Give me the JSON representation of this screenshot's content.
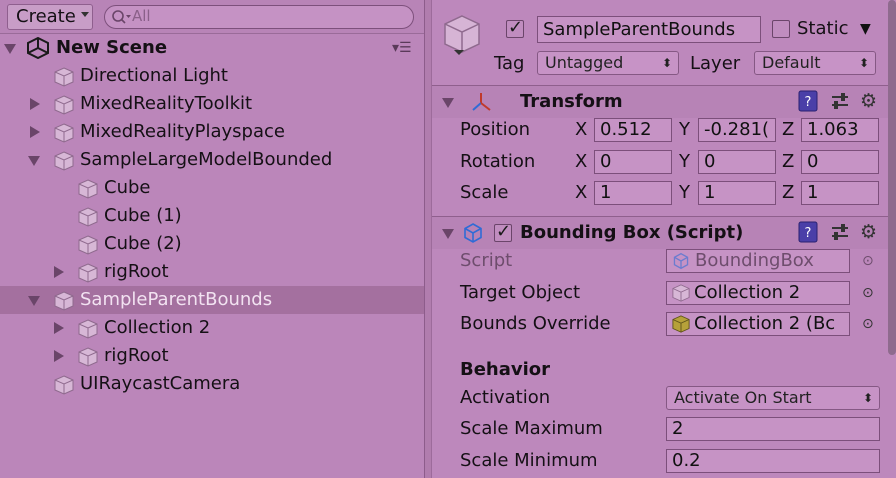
{
  "hierarchy": {
    "create_label": "Create",
    "search_placeholder": "All",
    "scene_name": "New Scene",
    "items": [
      {
        "label": "Directional Light"
      },
      {
        "label": "MixedRealityToolkit"
      },
      {
        "label": "MixedRealityPlayspace"
      },
      {
        "label": "SampleLargeModelBounded"
      },
      {
        "label": "Cube"
      },
      {
        "label": "Cube (1)"
      },
      {
        "label": "Cube (2)"
      },
      {
        "label": "rigRoot"
      },
      {
        "label": "SampleParentBounds",
        "selected": true
      },
      {
        "label": "Collection 2"
      },
      {
        "label": "rigRoot"
      },
      {
        "label": "UIRaycastCamera"
      }
    ]
  },
  "inspector": {
    "object_name": "SampleParentBounds",
    "static_label": "Static",
    "tag_label": "Tag",
    "tag_value": "Untagged",
    "layer_label": "Layer",
    "layer_value": "Default",
    "transform": {
      "title": "Transform",
      "position_label": "Position",
      "rotation_label": "Rotation",
      "scale_label": "Scale",
      "x": "X",
      "y": "Y",
      "z": "Z",
      "position": [
        "0.512",
        "-0.281(",
        "1.063"
      ],
      "rotation": [
        "0",
        "0",
        "0"
      ],
      "scale": [
        "1",
        "1",
        "1"
      ]
    },
    "bounding_box": {
      "title": "Bounding Box (Script)",
      "script_label": "Script",
      "script_value": "BoundingBox",
      "target_label": "Target Object",
      "target_value": "Collection 2",
      "override_label": "Bounds Override",
      "override_value": "Collection 2 (Bc",
      "behavior_header": "Behavior",
      "activation_label": "Activation",
      "activation_value": "Activate On Start",
      "scale_max_label": "Scale Maximum",
      "scale_max_value": "2",
      "scale_min_label": "Scale Minimum",
      "scale_min_value": "0.2"
    }
  }
}
